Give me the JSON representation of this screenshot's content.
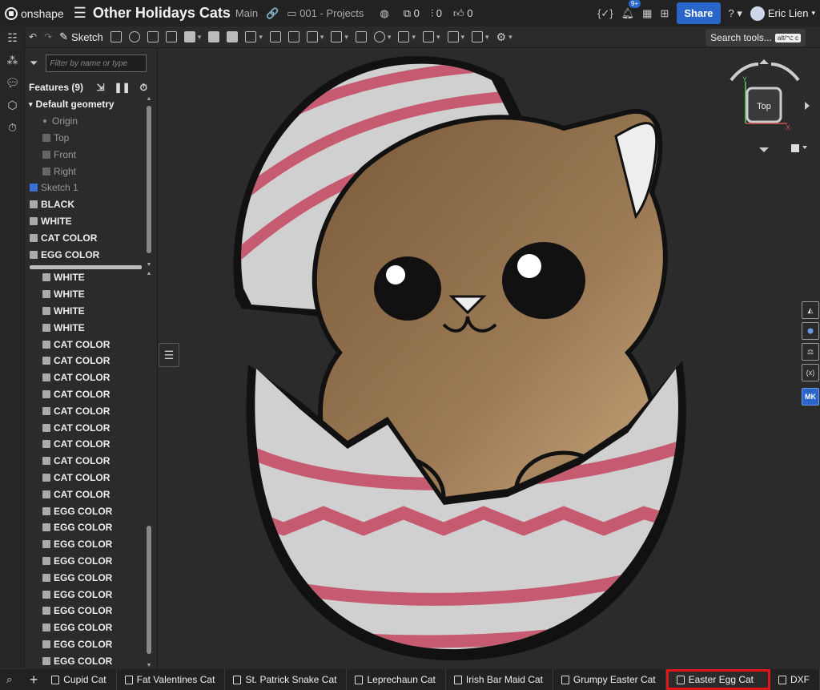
{
  "app": {
    "logo_text": "onshape"
  },
  "document": {
    "title": "Other Holidays Cats",
    "branch": "Main",
    "folder": "001 - Projects"
  },
  "counts": {
    "versions": "0",
    "branches": "0",
    "likes": "0"
  },
  "header": {
    "notifications_badge": "9+",
    "share_label": "Share",
    "help_label": "?",
    "user_name": "Eric Lien"
  },
  "toolbar": {
    "sketch_label": "Sketch",
    "search_label": "Search tools...",
    "search_shortcut": "alt/⌥ c"
  },
  "feature_panel": {
    "filter_placeholder": "Filter by name or type",
    "features_label": "Features (9)",
    "default_geometry_label": "Default geometry",
    "geometry_items": [
      "Origin",
      "Top",
      "Front",
      "Right"
    ],
    "feature_items": [
      "Sketch 1",
      "BLACK",
      "WHITE",
      "CAT COLOR",
      "EGG COLOR"
    ],
    "part_items": [
      "WHITE",
      "WHITE",
      "WHITE",
      "WHITE",
      "CAT COLOR",
      "CAT COLOR",
      "CAT COLOR",
      "CAT COLOR",
      "CAT COLOR",
      "CAT COLOR",
      "CAT COLOR",
      "CAT COLOR",
      "CAT COLOR",
      "CAT COLOR",
      "EGG COLOR",
      "EGG COLOR",
      "EGG COLOR",
      "EGG COLOR",
      "EGG COLOR",
      "EGG COLOR",
      "EGG COLOR",
      "EGG COLOR",
      "EGG COLOR",
      "EGG COLOR",
      "EGG COLOR"
    ]
  },
  "viewcube": {
    "face_label": "Top",
    "axis_x": "X",
    "axis_y": "Y"
  },
  "right_rail": {
    "mk_label": "MK"
  },
  "tabs": [
    {
      "label": "Cupid Cat"
    },
    {
      "label": "Fat Valentines Cat"
    },
    {
      "label": "St. Patrick Snake Cat"
    },
    {
      "label": "Leprechaun Cat"
    },
    {
      "label": "Irish Bar Maid Cat"
    },
    {
      "label": "Grumpy Easter Cat"
    },
    {
      "label": "Easter Egg Cat",
      "active": true
    },
    {
      "label": "DXF"
    }
  ],
  "colors": {
    "accent": "#2a66c9",
    "egg_pink": "#c65a70",
    "egg_white": "#d0d0d0",
    "cat_brown": "#9b7a55",
    "annotation_red": "#e0161b"
  }
}
